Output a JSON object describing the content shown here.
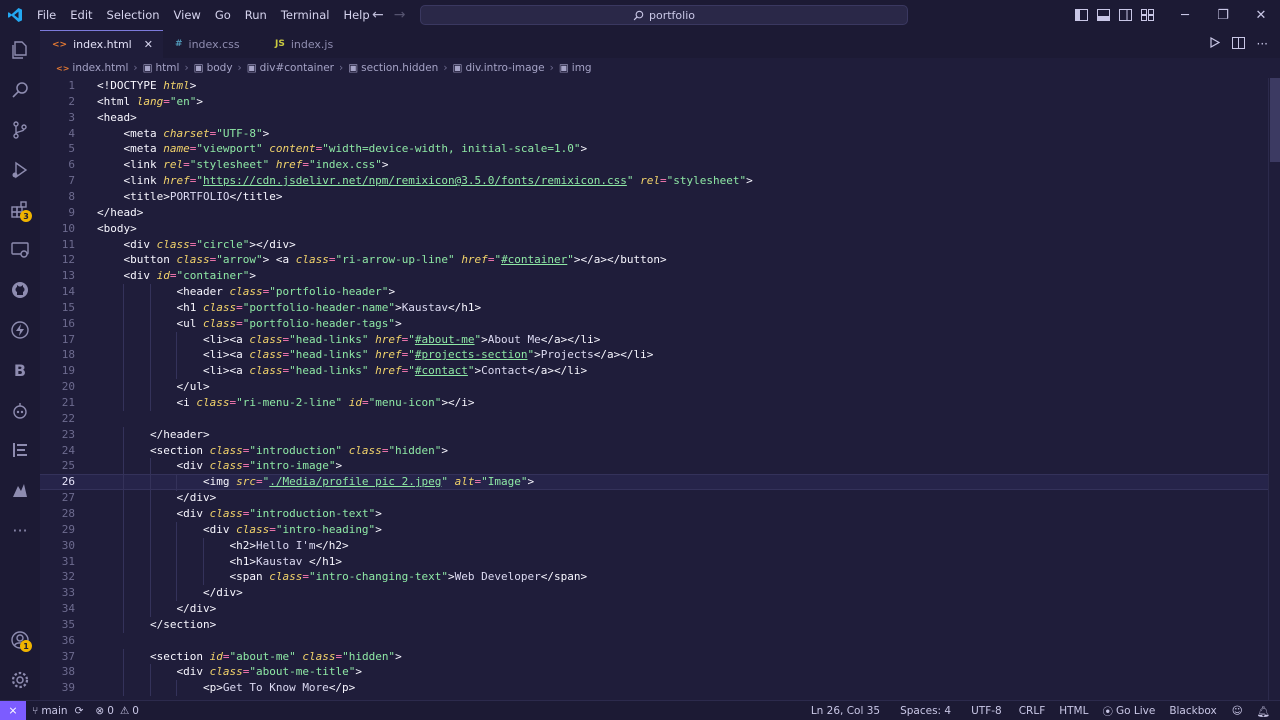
{
  "titlebar": {
    "menu": [
      "File",
      "Edit",
      "Selection",
      "View",
      "Go",
      "Run",
      "Terminal",
      "Help"
    ],
    "search": "portfolio",
    "window_controls": {
      "minimize": "─",
      "restore": "❐",
      "close": "✕"
    }
  },
  "activity": {
    "extensions_badge": "3",
    "accounts_badge": "1",
    "more": "···",
    "b_label": "B"
  },
  "tabs": [
    {
      "icon": "<>",
      "label": "index.html",
      "active": true,
      "close": "✕"
    },
    {
      "icon": "#",
      "label": "index.css",
      "active": false
    },
    {
      "icon": "JS",
      "label": "index.js",
      "active": false
    }
  ],
  "breadcrumb": [
    "index.html",
    "html",
    "body",
    "div#container",
    "section.hidden",
    "div.intro-image",
    "img"
  ],
  "editor": {
    "current_line": 26,
    "lines": [
      [
        [
          "t",
          "<!DOCTYPE "
        ],
        [
          "a",
          "html"
        ],
        [
          "t",
          ">"
        ]
      ],
      [
        [
          "t",
          "<html "
        ],
        [
          "a",
          "lang"
        ],
        [
          "e",
          "="
        ],
        [
          "s",
          "\"en\""
        ],
        [
          "t",
          ">"
        ]
      ],
      [
        [
          "t",
          "<head>"
        ]
      ],
      [
        [
          "i",
          "    "
        ],
        [
          "t",
          "<meta "
        ],
        [
          "a",
          "charset"
        ],
        [
          "e",
          "="
        ],
        [
          "s",
          "\"UTF-8\""
        ],
        [
          "t",
          ">"
        ]
      ],
      [
        [
          "i",
          "    "
        ],
        [
          "t",
          "<meta "
        ],
        [
          "a",
          "name"
        ],
        [
          "e",
          "="
        ],
        [
          "s",
          "\"viewport\" "
        ],
        [
          "a",
          "content"
        ],
        [
          "e",
          "="
        ],
        [
          "s",
          "\"width=device-width, initial-scale=1.0\""
        ],
        [
          "t",
          ">"
        ]
      ],
      [
        [
          "i",
          "    "
        ],
        [
          "t",
          "<link "
        ],
        [
          "a",
          "rel"
        ],
        [
          "e",
          "="
        ],
        [
          "s",
          "\"stylesheet\" "
        ],
        [
          "a",
          "href"
        ],
        [
          "e",
          "="
        ],
        [
          "s",
          "\"index.css\""
        ],
        [
          "t",
          ">"
        ]
      ],
      [
        [
          "i",
          "    "
        ],
        [
          "t",
          "<link "
        ],
        [
          "a",
          "href"
        ],
        [
          "e",
          "="
        ],
        [
          "s",
          "\""
        ],
        [
          "l",
          "https://cdn.jsdelivr.net/npm/remixicon@3.5.0/fonts/remixicon.css"
        ],
        [
          "s",
          "\" "
        ],
        [
          "a",
          "rel"
        ],
        [
          "e",
          "="
        ],
        [
          "s",
          "\"stylesheet\""
        ],
        [
          "t",
          ">"
        ]
      ],
      [
        [
          "i",
          "    "
        ],
        [
          "t",
          "<title>"
        ],
        [
          "x",
          "PORTFOLIO"
        ],
        [
          "t",
          "</title>"
        ]
      ],
      [
        [
          "t",
          "</head>"
        ]
      ],
      [
        [
          "t",
          "<body>"
        ]
      ],
      [
        [
          "i",
          "    "
        ],
        [
          "t",
          "<div "
        ],
        [
          "a",
          "class"
        ],
        [
          "e",
          "="
        ],
        [
          "s",
          "\"circle\""
        ],
        [
          "t",
          "></div>"
        ]
      ],
      [
        [
          "i",
          "    "
        ],
        [
          "t",
          "<button "
        ],
        [
          "a",
          "class"
        ],
        [
          "e",
          "="
        ],
        [
          "s",
          "\"arrow\""
        ],
        [
          "t",
          "> <a "
        ],
        [
          "a",
          "class"
        ],
        [
          "e",
          "="
        ],
        [
          "s",
          "\"ri-arrow-up-line\" "
        ],
        [
          "a",
          "href"
        ],
        [
          "e",
          "="
        ],
        [
          "s",
          "\""
        ],
        [
          "l",
          "#container"
        ],
        [
          "s",
          "\""
        ],
        [
          "t",
          "></a></button>"
        ]
      ],
      [
        [
          "i",
          "    "
        ],
        [
          "t",
          "<div "
        ],
        [
          "a",
          "id"
        ],
        [
          "e",
          "="
        ],
        [
          "s",
          "\"container\""
        ],
        [
          "t",
          ">"
        ]
      ],
      [
        [
          "i",
          "            "
        ],
        [
          "t",
          "<header "
        ],
        [
          "a",
          "class"
        ],
        [
          "e",
          "="
        ],
        [
          "s",
          "\"portfolio-header\""
        ],
        [
          "t",
          ">"
        ]
      ],
      [
        [
          "i",
          "            "
        ],
        [
          "t",
          "<h1 "
        ],
        [
          "a",
          "class"
        ],
        [
          "e",
          "="
        ],
        [
          "s",
          "\"portfolio-header-name\""
        ],
        [
          "t",
          ">"
        ],
        [
          "x",
          "Kaustav"
        ],
        [
          "t",
          "</h1>"
        ]
      ],
      [
        [
          "i",
          "            "
        ],
        [
          "t",
          "<ul "
        ],
        [
          "a",
          "class"
        ],
        [
          "e",
          "="
        ],
        [
          "s",
          "\"portfolio-header-tags\""
        ],
        [
          "t",
          ">"
        ]
      ],
      [
        [
          "i",
          "                "
        ],
        [
          "t",
          "<li><a "
        ],
        [
          "a",
          "class"
        ],
        [
          "e",
          "="
        ],
        [
          "s",
          "\"head-links\" "
        ],
        [
          "a",
          "href"
        ],
        [
          "e",
          "="
        ],
        [
          "s",
          "\""
        ],
        [
          "l",
          "#about-me"
        ],
        [
          "s",
          "\""
        ],
        [
          "t",
          ">"
        ],
        [
          "x",
          "About Me"
        ],
        [
          "t",
          "</a></li>"
        ]
      ],
      [
        [
          "i",
          "                "
        ],
        [
          "t",
          "<li><a "
        ],
        [
          "a",
          "class"
        ],
        [
          "e",
          "="
        ],
        [
          "s",
          "\"head-links\" "
        ],
        [
          "a",
          "href"
        ],
        [
          "e",
          "="
        ],
        [
          "s",
          "\""
        ],
        [
          "l",
          "#projects-section"
        ],
        [
          "s",
          "\""
        ],
        [
          "t",
          ">"
        ],
        [
          "x",
          "Projects"
        ],
        [
          "t",
          "</a></li>"
        ]
      ],
      [
        [
          "i",
          "                "
        ],
        [
          "t",
          "<li><a "
        ],
        [
          "a",
          "class"
        ],
        [
          "e",
          "="
        ],
        [
          "s",
          "\"head-links\" "
        ],
        [
          "a",
          "href"
        ],
        [
          "e",
          "="
        ],
        [
          "s",
          "\""
        ],
        [
          "l",
          "#contact"
        ],
        [
          "s",
          "\""
        ],
        [
          "t",
          ">"
        ],
        [
          "x",
          "Contact"
        ],
        [
          "t",
          "</a></li>"
        ]
      ],
      [
        [
          "i",
          "            "
        ],
        [
          "t",
          "</ul>"
        ]
      ],
      [
        [
          "i",
          "            "
        ],
        [
          "t",
          "<i "
        ],
        [
          "a",
          "class"
        ],
        [
          "e",
          "="
        ],
        [
          "s",
          "\"ri-menu-2-line\" "
        ],
        [
          "a",
          "id"
        ],
        [
          "e",
          "="
        ],
        [
          "s",
          "\"menu-icon\""
        ],
        [
          "t",
          "></i>"
        ]
      ],
      [],
      [
        [
          "i",
          "        "
        ],
        [
          "t",
          "</header>"
        ]
      ],
      [
        [
          "i",
          "        "
        ],
        [
          "t",
          "<section "
        ],
        [
          "a",
          "class"
        ],
        [
          "e",
          "="
        ],
        [
          "s",
          "\"introduction\" "
        ],
        [
          "a",
          "class"
        ],
        [
          "e",
          "="
        ],
        [
          "s",
          "\"hidden\""
        ],
        [
          "t",
          ">"
        ]
      ],
      [
        [
          "i",
          "            "
        ],
        [
          "t",
          "<div "
        ],
        [
          "a",
          "class"
        ],
        [
          "e",
          "="
        ],
        [
          "s",
          "\"intro-image\""
        ],
        [
          "t",
          ">"
        ]
      ],
      [
        [
          "i",
          "                "
        ],
        [
          "t",
          "<img "
        ],
        [
          "a",
          "src"
        ],
        [
          "e",
          "="
        ],
        [
          "s",
          "\""
        ],
        [
          "l",
          "./Media/profile pic 2.jpeg"
        ],
        [
          "s",
          "\" "
        ],
        [
          "a",
          "alt"
        ],
        [
          "e",
          "="
        ],
        [
          "s",
          "\"Image\""
        ],
        [
          "t",
          ">"
        ]
      ],
      [
        [
          "i",
          "            "
        ],
        [
          "t",
          "</div>"
        ]
      ],
      [
        [
          "i",
          "            "
        ],
        [
          "t",
          "<div "
        ],
        [
          "a",
          "class"
        ],
        [
          "e",
          "="
        ],
        [
          "s",
          "\"introduction-text\""
        ],
        [
          "t",
          ">"
        ]
      ],
      [
        [
          "i",
          "                "
        ],
        [
          "t",
          "<div "
        ],
        [
          "a",
          "class"
        ],
        [
          "e",
          "="
        ],
        [
          "s",
          "\"intro-heading\""
        ],
        [
          "t",
          ">"
        ]
      ],
      [
        [
          "i",
          "                    "
        ],
        [
          "t",
          "<h2>"
        ],
        [
          "x",
          "Hello I'm"
        ],
        [
          "t",
          "</h2>"
        ]
      ],
      [
        [
          "i",
          "                    "
        ],
        [
          "t",
          "<h1>"
        ],
        [
          "x",
          "Kaustav "
        ],
        [
          "t",
          "</h1>"
        ]
      ],
      [
        [
          "i",
          "                    "
        ],
        [
          "t",
          "<span "
        ],
        [
          "a",
          "class"
        ],
        [
          "e",
          "="
        ],
        [
          "s",
          "\"intro-changing-text\""
        ],
        [
          "t",
          ">"
        ],
        [
          "x",
          "Web Developer"
        ],
        [
          "t",
          "</span>"
        ]
      ],
      [
        [
          "i",
          "                "
        ],
        [
          "t",
          "</div>"
        ]
      ],
      [
        [
          "i",
          "            "
        ],
        [
          "t",
          "</div>"
        ]
      ],
      [
        [
          "i",
          "        "
        ],
        [
          "t",
          "</section>"
        ]
      ],
      [],
      [
        [
          "i",
          "        "
        ],
        [
          "t",
          "<section "
        ],
        [
          "a",
          "id"
        ],
        [
          "e",
          "="
        ],
        [
          "s",
          "\"about-me\" "
        ],
        [
          "a",
          "class"
        ],
        [
          "e",
          "="
        ],
        [
          "s",
          "\"hidden\""
        ],
        [
          "t",
          ">"
        ]
      ],
      [
        [
          "i",
          "            "
        ],
        [
          "t",
          "<div "
        ],
        [
          "a",
          "class"
        ],
        [
          "e",
          "="
        ],
        [
          "s",
          "\"about-me-title\""
        ],
        [
          "t",
          ">"
        ]
      ],
      [
        [
          "i",
          "                "
        ],
        [
          "t",
          "<p>"
        ],
        [
          "x",
          "Get To Know More"
        ],
        [
          "t",
          "</p>"
        ]
      ]
    ]
  },
  "statusbar": {
    "branch": "main",
    "errors": "0",
    "warnings": "0",
    "position": "Ln 26, Col 35",
    "spaces": "Spaces: 4",
    "encoding": "UTF-8",
    "eol": "CRLF",
    "language": "HTML",
    "golive": "Go Live",
    "blackbox": "Blackbox"
  },
  "colors": {
    "background": "#1f1d3a",
    "chrome": "#1c1a34",
    "tag": "#f8f7ff",
    "attribute": "#f3d46b",
    "equals": "#ff7eb6",
    "string": "#8ee8a5",
    "accent": "#7c5cff"
  }
}
